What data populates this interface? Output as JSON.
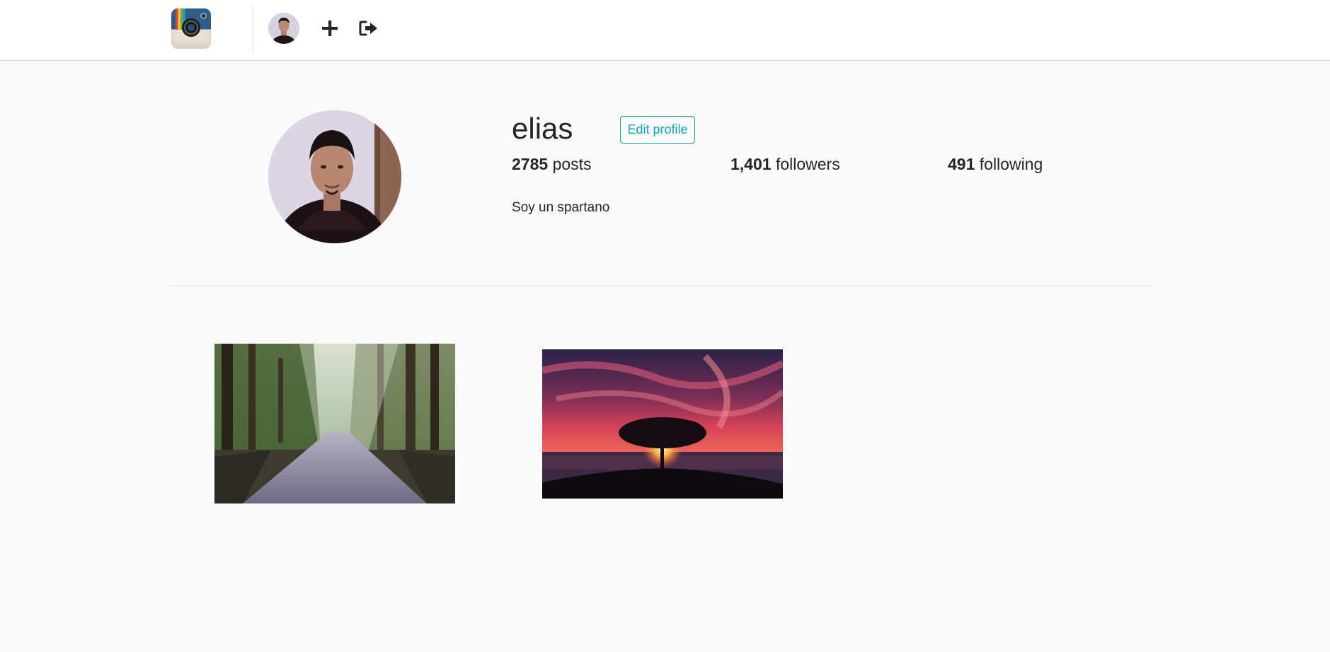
{
  "nav": {
    "logo_icon": "camera-logo-icon",
    "avatar_icon": "user-avatar",
    "add_icon": "plus-icon",
    "logout_icon": "sign-out-icon"
  },
  "profile": {
    "username": "elias",
    "edit_label": "Edit profile",
    "posts_count": "2785",
    "posts_label": "posts",
    "followers_count": "1,401",
    "followers_label": "followers",
    "following_count": "491",
    "following_label": "following",
    "bio": "Soy un spartano"
  },
  "posts": [
    {
      "subject": "forest-road"
    },
    {
      "subject": "tree-sunset"
    }
  ],
  "colors": {
    "accent": "#17a2b8",
    "background": "#fafafa",
    "text": "#262626"
  }
}
